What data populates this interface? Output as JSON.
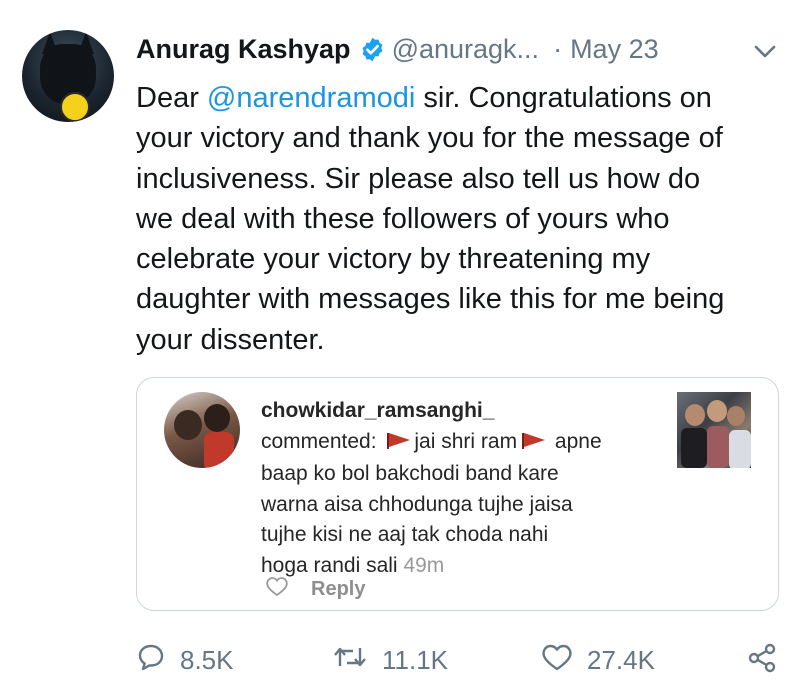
{
  "tweet": {
    "author_name": "Anurag Kashyap",
    "handle": "@anuragk...",
    "separator": "·",
    "date": "May 23",
    "text_lines": [
      [
        "Dear ",
        "@narendramodi",
        " sir. Congratulations on"
      ],
      "your victory and thank you for the message of",
      "inclusiveness. Sir please also tell us how do",
      "we deal with these followers of yours who",
      "celebrate your victory by threatening my",
      "daughter with messages like this for me being",
      "your dissenter."
    ],
    "mention": "@narendramodi"
  },
  "embedded_comment": {
    "username": "chowkidar_ramsanghi_",
    "line1_prefix": "commented: ",
    "line1_mid": "jai shri ram",
    "line1_suffix": " apne",
    "lines": [
      "baap ko bol bakchodi band kare",
      "warna aisa chhodunga tujhe jaisa",
      "tujhe kisi ne aaj tak choda nahi"
    ],
    "last_line_text": "hoga randi sali ",
    "time": "49m",
    "reply_label": "Reply"
  },
  "actions": {
    "replies": "8.5K",
    "retweets": "11.1K",
    "likes": "27.4K"
  },
  "colors": {
    "link": "#1b95e0",
    "muted": "#657786",
    "verified": "#1da1f2",
    "flag": "#c0392b",
    "card_border": "#ccd6dd"
  },
  "icons": [
    "verified-badge-icon",
    "chevron-down-icon",
    "flag-icon",
    "heart-outline-icon",
    "reply-bubble-icon",
    "retweet-icon",
    "like-heart-icon",
    "share-icon"
  ]
}
